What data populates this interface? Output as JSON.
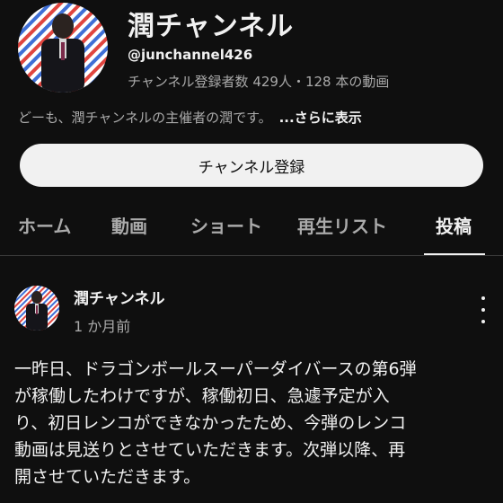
{
  "channel": {
    "name": "潤チャンネル",
    "handle": "@junchannel426",
    "stats": "チャンネル登録者数 429人・128 本の動画",
    "description": "どーも、潤チャンネルの主催者の潤です。",
    "more_label": "...さらに表示",
    "subscribe_label": "チャンネル登録"
  },
  "tabs": [
    {
      "label": "ホーム",
      "active": false
    },
    {
      "label": "動画",
      "active": false
    },
    {
      "label": "ショート",
      "active": false
    },
    {
      "label": "再生リスト",
      "active": false
    },
    {
      "label": "投稿",
      "active": true
    }
  ],
  "post": {
    "author": "潤チャンネル",
    "time": "1 か月前",
    "body_lines": [
      "一昨日、ドラゴンボールスーパーダイバースの第6弾",
      "が稼働したわけですが、稼働初日、急遽予定が入",
      "り、初日レンコができなかったため、今弾のレンコ",
      "動画は見送りとさせていただきます。次弾以降、再",
      "開させていただきます。"
    ]
  },
  "colors": {
    "background": "#0f0f0f",
    "text": "#f1f1f1",
    "muted": "#aaaaaa",
    "button_bg": "#f1f1f1",
    "stripe_red": "#e0453f",
    "stripe_blue": "#3f6fd6"
  }
}
